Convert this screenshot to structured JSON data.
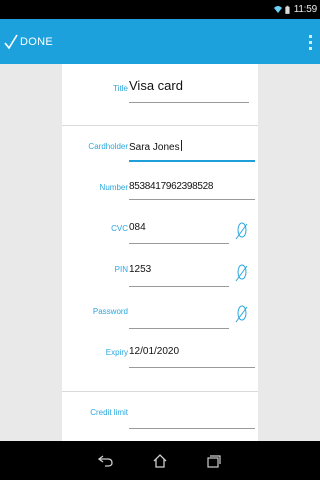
{
  "status_bar": {
    "time": "11:59"
  },
  "action_bar": {
    "done_label": "DONE"
  },
  "form": {
    "fields": [
      {
        "label": "Title",
        "value": "Visa card"
      },
      {
        "label": "Cardholder",
        "value": "Sara Jones"
      },
      {
        "label": "Number",
        "value": "8538417962398528"
      },
      {
        "label": "CVC",
        "value": "084"
      },
      {
        "label": "PIN",
        "value": "1253"
      },
      {
        "label": "Password",
        "value": ""
      },
      {
        "label": "Expiry",
        "value": "12/01/2020"
      },
      {
        "label": "Credit limit",
        "value": ""
      }
    ]
  },
  "icons": {
    "wifi": "wifi-icon",
    "battery": "battery-icon",
    "done": "checkmark-icon",
    "overflow": "overflow-menu-icon",
    "toggle": "visibility-toggle-icon",
    "back": "back-icon",
    "home": "home-icon",
    "recents": "recent-apps-icon"
  },
  "colors": {
    "accent": "#1da1dd",
    "label": "#2aa6de",
    "status_bar": "#000000",
    "background": "#e9e9e9"
  }
}
